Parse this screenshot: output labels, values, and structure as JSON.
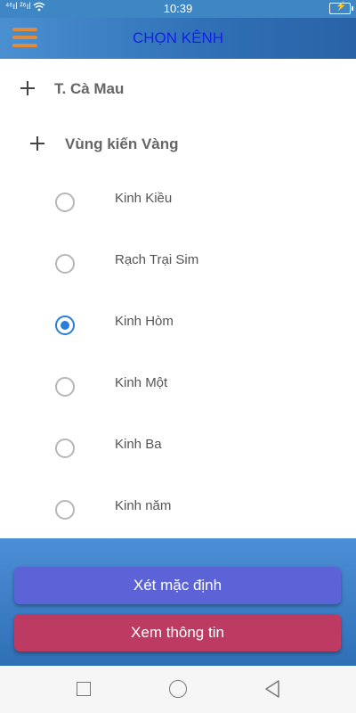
{
  "status_bar": {
    "signal_text": "⁴⁶ıl ²⁶ıl",
    "time": "10:39",
    "icons": [
      "signal-icon",
      "wifi-icon",
      "battery-charging-icon"
    ]
  },
  "app_bar": {
    "title": "CHỌN KÊNH",
    "title_color": "#1321e6",
    "menu_icon": "hamburger-menu-icon",
    "menu_color": "#e08a3c"
  },
  "tree": {
    "province": {
      "label": "T. Cà Mau",
      "icon": "plus-icon"
    },
    "zone": {
      "label": "Vùng kiến Vàng",
      "icon": "plus-icon"
    },
    "channels": [
      {
        "label": "Kinh Kiều",
        "selected": false
      },
      {
        "label": "Rạch Trại Sim",
        "selected": false
      },
      {
        "label": "Kinh Hòm",
        "selected": true
      },
      {
        "label": "Kinh Một",
        "selected": false
      },
      {
        "label": "Kinh Ba",
        "selected": false
      },
      {
        "label": "Kinh năm",
        "selected": false
      }
    ],
    "radio_selected_color": "#2a7fd4"
  },
  "actions": {
    "set_default_label": "Xét mặc định",
    "set_default_color": "#5b63d6",
    "view_info_label": "Xem thông tin",
    "view_info_color": "#bd3b62"
  },
  "nav_bar": {
    "icons": [
      "recents-square-icon",
      "home-circle-icon",
      "back-triangle-icon"
    ]
  }
}
